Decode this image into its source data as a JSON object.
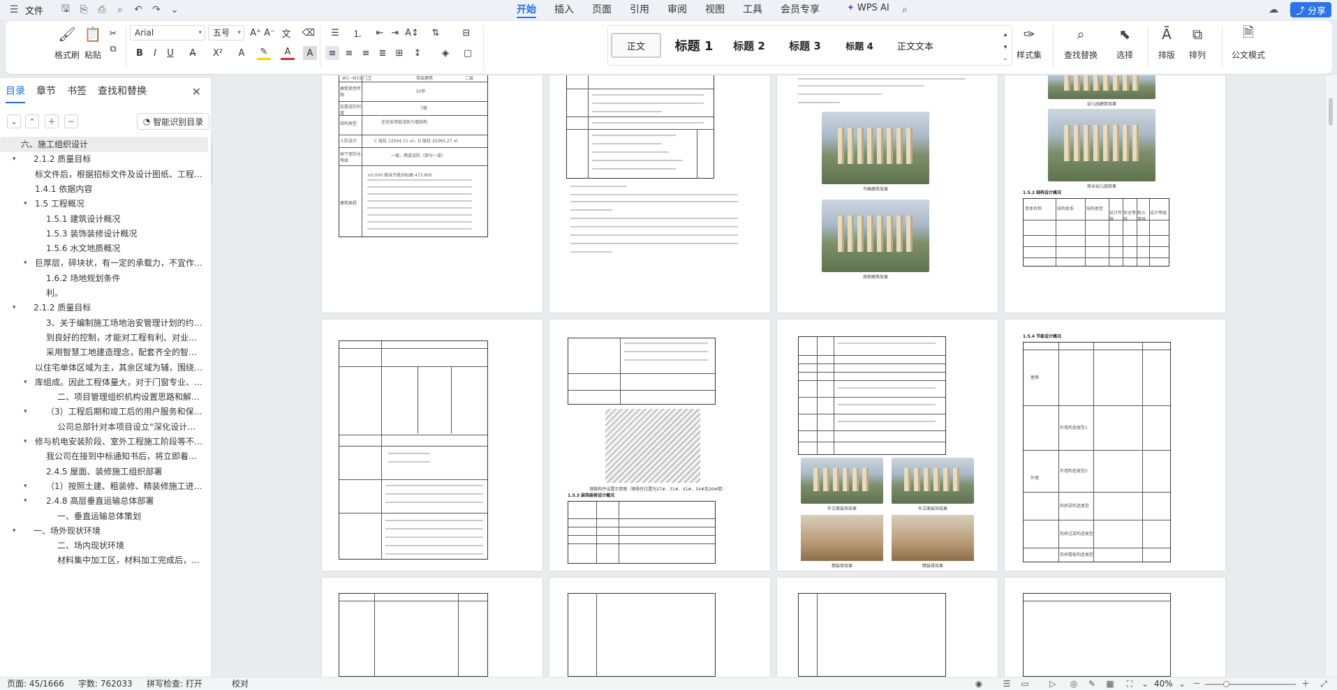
{
  "menubar": {
    "file_label": "文件",
    "tabs": [
      "开始",
      "插入",
      "页面",
      "引用",
      "审阅",
      "视图",
      "工具",
      "会员专享"
    ],
    "wps_ai": "WPS AI",
    "share_label": "分享"
  },
  "ribbon": {
    "format_painter": "格式刷",
    "paste": "粘贴",
    "font_name": "Arial",
    "font_size": "五号",
    "styles": [
      "正文",
      "标题 1",
      "标题 2",
      "标题 3",
      "标题 4",
      "正文文本"
    ],
    "style_set": "样式集",
    "find_replace": "查找替换",
    "select": "选择",
    "layout": "排版",
    "arrange": "排列",
    "formula_mode": "公文模式"
  },
  "nav": {
    "tabs": [
      "目录",
      "章节",
      "书签",
      "查找和替换"
    ],
    "smart_btn": "智能识别目录",
    "items": [
      {
        "text": "六、施工组织设计",
        "indent": 0,
        "twisty": "",
        "selected": true
      },
      {
        "text": "2.1.2 质量目标",
        "indent": 1,
        "twisty": "▾"
      },
      {
        "text": "标文件后，根据招标文件及设计图纸、工程…",
        "indent": 2,
        "twisty": ""
      },
      {
        "text": "1.4.1 依据内容",
        "indent": 2,
        "twisty": ""
      },
      {
        "text": "1.5 工程概况",
        "indent": 2,
        "twisty": "▾"
      },
      {
        "text": "1.5.1 建筑设计概况",
        "indent": 3,
        "twisty": ""
      },
      {
        "text": "1.5.3 装饰装修设计概况",
        "indent": 3,
        "twisty": ""
      },
      {
        "text": "1.5.6 水文地质概况",
        "indent": 3,
        "twisty": ""
      },
      {
        "text": "巨厚层，碎块状，有一定的承载力，不宜作…",
        "indent": 2,
        "twisty": "▾"
      },
      {
        "text": "1.6.2 场地规划条件",
        "indent": 3,
        "twisty": ""
      },
      {
        "text": "利。",
        "indent": 3,
        "twisty": ""
      },
      {
        "text": "2.1.2 质量目标",
        "indent": 1,
        "twisty": "▾"
      },
      {
        "text": "3、关于编制施工场地治安管理计划的约…",
        "indent": 3,
        "twisty": ""
      },
      {
        "text": "到良好的控制，才能对工程有利、对业…",
        "indent": 3,
        "twisty": ""
      },
      {
        "text": "采用智慧工地建造理念，配套齐全的智…",
        "indent": 3,
        "twisty": ""
      },
      {
        "text": "以住宅单体区域为主，其余区域为辅，围绕…",
        "indent": 2,
        "twisty": ""
      },
      {
        "text": "库组成。因此工程体量大，对于门窗专业、…",
        "indent": 2,
        "twisty": "▾"
      },
      {
        "text": "二、项目管理组织机构设置思路和解…",
        "indent": 4,
        "twisty": ""
      },
      {
        "text": "（3）工程后期和竣工后的用户服务和保…",
        "indent": 3,
        "twisty": "▾"
      },
      {
        "text": "公司总部针对本项目设立“深化设计…",
        "indent": 4,
        "twisty": ""
      },
      {
        "text": "修与机电安装阶段、室外工程施工阶段等不…",
        "indent": 2,
        "twisty": "▾"
      },
      {
        "text": "我公司在接到中标通知书后，将立即着…",
        "indent": 3,
        "twisty": ""
      },
      {
        "text": "2.4.5 屋面、装修施工组织部署",
        "indent": 3,
        "twisty": ""
      },
      {
        "text": "（1）按照土建、粗装修、精装修施工进…",
        "indent": 3,
        "twisty": "▾"
      },
      {
        "text": "2.4.8 高层垂直运输总体部署",
        "indent": 3,
        "twisty": "▾"
      },
      {
        "text": "一、垂直运输总体策划",
        "indent": 4,
        "twisty": ""
      },
      {
        "text": "一、场外现状环境",
        "indent": 1,
        "twisty": "▾"
      },
      {
        "text": "二、场内现状环境",
        "indent": 4,
        "twisty": ""
      },
      {
        "text": "材料集中加工区，材料加工完成后，…",
        "indent": 4,
        "twisty": ""
      }
    ]
  },
  "doc": {
    "p1": {
      "rows": [
        "W1~W15 门卫",
        "单层建筑",
        "二层"
      ],
      "labels": [
        "建筑使用年限",
        "抗震设防烈度",
        "结构类型",
        "人防设计",
        "地下室防水等级",
        "建筑高程"
      ],
      "values": [
        "50年",
        "7度",
        "住宅采用现浇剪力墙结构",
        "C 级抗 12564.11 ㎡，D 级抗 20365.27 ㎡",
        "一级，两道设防（部分一道）",
        "±0.000 相当于绝对标高 473.800"
      ]
    },
    "p3_caps": [
      "鸟瞰建筑效果",
      "南侧建筑效果"
    ],
    "p4_caps": [
      "幼儿园建筑效果",
      "商业幼儿园效果",
      "1.5.2 结构设计概况"
    ],
    "p4_headers": [
      "单体名称",
      "结构体系",
      "结构类型",
      "设计年限",
      "安全等级",
      "耐火等级",
      "设计等级"
    ],
    "p6_title": "1.5.3 装饰装修设计概况",
    "p6_cap": "钢筋构件设置示意图（钢骨柱位置为27#、31#、41#、54#及26#楼）",
    "p7_caps": [
      "外立面装饰效果",
      "外立面装饰效果",
      "精装修效果",
      "精装修效果"
    ],
    "p8_title": "1.5.4 节能设计概况",
    "p8_rows": [
      "屋面",
      "外墙",
      "外墙构造类型1",
      "外墙构造类型2",
      "热桥梁构造类型",
      "热桥过梁构造类型",
      "热桥楼板构造类型"
    ]
  },
  "status": {
    "page": "页面: 45/1666",
    "words": "字数: 762033",
    "spell": "拼写检查: 打开",
    "proof": "校对",
    "zoom": "40%"
  },
  "colors": {
    "accent": "#1f6fe5",
    "share_bg": "#2a73e8"
  }
}
